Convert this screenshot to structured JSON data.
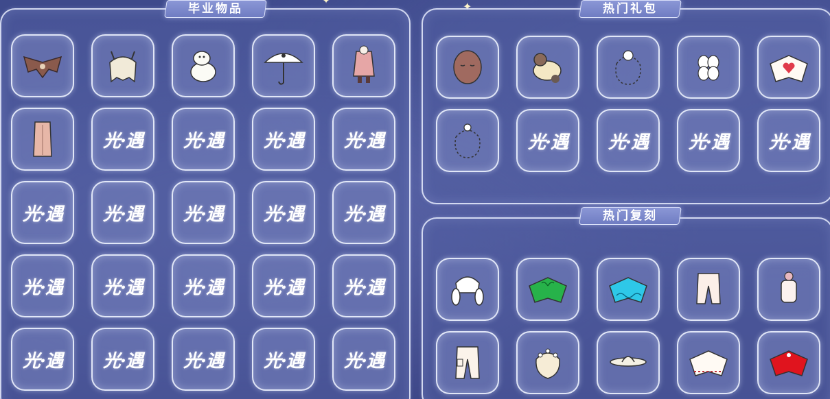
{
  "sections": {
    "graduation": {
      "title": "毕业物品",
      "items": [
        "bat-cape-icon",
        "animal-ear-hair-icon",
        "moomin-figure-icon",
        "cat-umbrella-icon",
        "pink-coat-icon",
        "long-cape-icon",
        "logo",
        "logo",
        "logo",
        "logo",
        "logo",
        "logo",
        "logo",
        "logo",
        "logo",
        "logo",
        "logo",
        "logo",
        "logo",
        "logo",
        "logo",
        "logo",
        "logo",
        "logo",
        "logo"
      ]
    },
    "gift_packs": {
      "title": "热门礼包",
      "items": [
        "mask-icon",
        "lamb-figure-icon",
        "cat-outline-hair-icon",
        "flower-hairpin-icon",
        "heart-cape-icon",
        "outline-hair-icon",
        "logo",
        "logo",
        "logo",
        "logo"
      ]
    },
    "reruns": {
      "title": "热门复刻",
      "items": [
        "twin-tail-hair-icon",
        "green-leaf-cape-icon",
        "blue-wave-cape-icon",
        "white-pants-icon",
        "bunny-outfit-icon",
        "cargo-pants-icon",
        "flower-crown-hair-icon",
        "straw-hat-icon",
        "white-red-cape-icon",
        "red-cape-icon"
      ]
    }
  },
  "logo_text": "光·遇",
  "colors": {
    "background": "#46519a",
    "panel_border": "#ebf0ff",
    "title_bg": "#7e8acd",
    "green_cape": "#27b24a",
    "blue_cape": "#2ec8e8",
    "red_cape": "#e0141e"
  }
}
